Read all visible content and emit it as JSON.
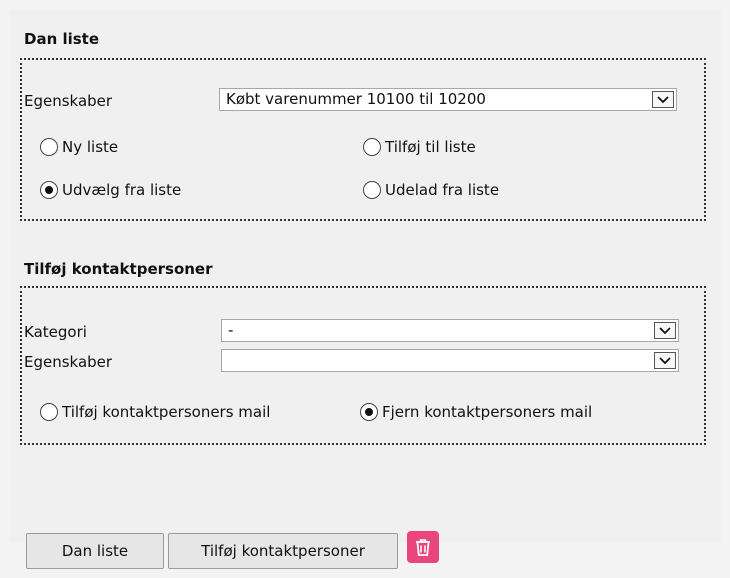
{
  "dan_liste": {
    "title": "Dan liste",
    "egenskaber_label": "Egenskaber",
    "egenskaber_value": "Købt varenummer 10100 til 10200",
    "radios": [
      {
        "label": "Ny liste",
        "checked": false
      },
      {
        "label": "Tilføj til liste",
        "checked": false
      },
      {
        "label": "Udvælg fra liste",
        "checked": true
      },
      {
        "label": "Udelad fra liste",
        "checked": false
      }
    ]
  },
  "kontakt": {
    "title": "Tilføj kontaktpersoner",
    "kategori_label": "Kategori",
    "kategori_value": "-",
    "egenskaber_label": "Egenskaber",
    "egenskaber_value": "",
    "radios": [
      {
        "label": "Tilføj kontaktpersoners mail",
        "checked": false
      },
      {
        "label": "Fjern kontaktpersoners mail",
        "checked": true
      }
    ]
  },
  "buttons": {
    "dan_liste": "Dan liste",
    "tilfoj_kontaktpersoner": "Tilføj kontaktpersoner"
  },
  "icons": {
    "chevron": "chevron-down-icon",
    "trash": "trash-icon"
  },
  "colors": {
    "trash_bg": "#e8467c"
  }
}
